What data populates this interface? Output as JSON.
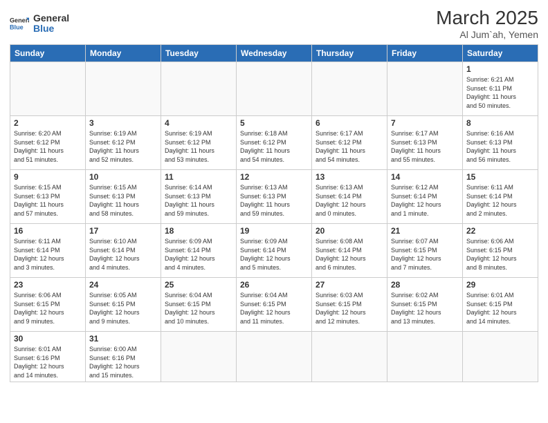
{
  "header": {
    "logo_general": "General",
    "logo_blue": "Blue",
    "month": "March 2025",
    "location": "Al Jum`ah, Yemen"
  },
  "days_of_week": [
    "Sunday",
    "Monday",
    "Tuesday",
    "Wednesday",
    "Thursday",
    "Friday",
    "Saturday"
  ],
  "weeks": [
    [
      {
        "day": "",
        "info": ""
      },
      {
        "day": "",
        "info": ""
      },
      {
        "day": "",
        "info": ""
      },
      {
        "day": "",
        "info": ""
      },
      {
        "day": "",
        "info": ""
      },
      {
        "day": "",
        "info": ""
      },
      {
        "day": "1",
        "info": "Sunrise: 6:21 AM\nSunset: 6:11 PM\nDaylight: 11 hours\nand 50 minutes."
      }
    ],
    [
      {
        "day": "2",
        "info": "Sunrise: 6:20 AM\nSunset: 6:12 PM\nDaylight: 11 hours\nand 51 minutes."
      },
      {
        "day": "3",
        "info": "Sunrise: 6:19 AM\nSunset: 6:12 PM\nDaylight: 11 hours\nand 52 minutes."
      },
      {
        "day": "4",
        "info": "Sunrise: 6:19 AM\nSunset: 6:12 PM\nDaylight: 11 hours\nand 53 minutes."
      },
      {
        "day": "5",
        "info": "Sunrise: 6:18 AM\nSunset: 6:12 PM\nDaylight: 11 hours\nand 54 minutes."
      },
      {
        "day": "6",
        "info": "Sunrise: 6:17 AM\nSunset: 6:12 PM\nDaylight: 11 hours\nand 54 minutes."
      },
      {
        "day": "7",
        "info": "Sunrise: 6:17 AM\nSunset: 6:13 PM\nDaylight: 11 hours\nand 55 minutes."
      },
      {
        "day": "8",
        "info": "Sunrise: 6:16 AM\nSunset: 6:13 PM\nDaylight: 11 hours\nand 56 minutes."
      }
    ],
    [
      {
        "day": "9",
        "info": "Sunrise: 6:15 AM\nSunset: 6:13 PM\nDaylight: 11 hours\nand 57 minutes."
      },
      {
        "day": "10",
        "info": "Sunrise: 6:15 AM\nSunset: 6:13 PM\nDaylight: 11 hours\nand 58 minutes."
      },
      {
        "day": "11",
        "info": "Sunrise: 6:14 AM\nSunset: 6:13 PM\nDaylight: 11 hours\nand 59 minutes."
      },
      {
        "day": "12",
        "info": "Sunrise: 6:13 AM\nSunset: 6:13 PM\nDaylight: 11 hours\nand 59 minutes."
      },
      {
        "day": "13",
        "info": "Sunrise: 6:13 AM\nSunset: 6:14 PM\nDaylight: 12 hours\nand 0 minutes."
      },
      {
        "day": "14",
        "info": "Sunrise: 6:12 AM\nSunset: 6:14 PM\nDaylight: 12 hours\nand 1 minute."
      },
      {
        "day": "15",
        "info": "Sunrise: 6:11 AM\nSunset: 6:14 PM\nDaylight: 12 hours\nand 2 minutes."
      }
    ],
    [
      {
        "day": "16",
        "info": "Sunrise: 6:11 AM\nSunset: 6:14 PM\nDaylight: 12 hours\nand 3 minutes."
      },
      {
        "day": "17",
        "info": "Sunrise: 6:10 AM\nSunset: 6:14 PM\nDaylight: 12 hours\nand 4 minutes."
      },
      {
        "day": "18",
        "info": "Sunrise: 6:09 AM\nSunset: 6:14 PM\nDaylight: 12 hours\nand 4 minutes."
      },
      {
        "day": "19",
        "info": "Sunrise: 6:09 AM\nSunset: 6:14 PM\nDaylight: 12 hours\nand 5 minutes."
      },
      {
        "day": "20",
        "info": "Sunrise: 6:08 AM\nSunset: 6:14 PM\nDaylight: 12 hours\nand 6 minutes."
      },
      {
        "day": "21",
        "info": "Sunrise: 6:07 AM\nSunset: 6:15 PM\nDaylight: 12 hours\nand 7 minutes."
      },
      {
        "day": "22",
        "info": "Sunrise: 6:06 AM\nSunset: 6:15 PM\nDaylight: 12 hours\nand 8 minutes."
      }
    ],
    [
      {
        "day": "23",
        "info": "Sunrise: 6:06 AM\nSunset: 6:15 PM\nDaylight: 12 hours\nand 9 minutes."
      },
      {
        "day": "24",
        "info": "Sunrise: 6:05 AM\nSunset: 6:15 PM\nDaylight: 12 hours\nand 9 minutes."
      },
      {
        "day": "25",
        "info": "Sunrise: 6:04 AM\nSunset: 6:15 PM\nDaylight: 12 hours\nand 10 minutes."
      },
      {
        "day": "26",
        "info": "Sunrise: 6:04 AM\nSunset: 6:15 PM\nDaylight: 12 hours\nand 11 minutes."
      },
      {
        "day": "27",
        "info": "Sunrise: 6:03 AM\nSunset: 6:15 PM\nDaylight: 12 hours\nand 12 minutes."
      },
      {
        "day": "28",
        "info": "Sunrise: 6:02 AM\nSunset: 6:15 PM\nDaylight: 12 hours\nand 13 minutes."
      },
      {
        "day": "29",
        "info": "Sunrise: 6:01 AM\nSunset: 6:15 PM\nDaylight: 12 hours\nand 14 minutes."
      }
    ],
    [
      {
        "day": "30",
        "info": "Sunrise: 6:01 AM\nSunset: 6:16 PM\nDaylight: 12 hours\nand 14 minutes."
      },
      {
        "day": "31",
        "info": "Sunrise: 6:00 AM\nSunset: 6:16 PM\nDaylight: 12 hours\nand 15 minutes."
      },
      {
        "day": "",
        "info": ""
      },
      {
        "day": "",
        "info": ""
      },
      {
        "day": "",
        "info": ""
      },
      {
        "day": "",
        "info": ""
      },
      {
        "day": "",
        "info": ""
      }
    ]
  ]
}
